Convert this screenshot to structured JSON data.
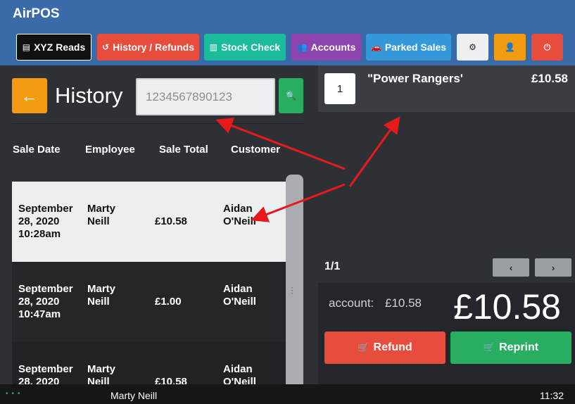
{
  "app": {
    "title": "AirPOS"
  },
  "toolbar": {
    "buttons": [
      {
        "label": "XYZ Reads",
        "icon": "list-icon",
        "glyph": "▤",
        "color": "#111111"
      },
      {
        "label": "History / Refunds",
        "icon": "history-icon",
        "glyph": "↺",
        "color": "#e74c3c"
      },
      {
        "label": "Stock Check",
        "icon": "barcode-icon",
        "glyph": "▥",
        "color": "#1abc9c"
      },
      {
        "label": "Accounts",
        "icon": "users-icon",
        "glyph": "👥",
        "color": "#8e44ad"
      },
      {
        "label": "Parked Sales",
        "icon": "car-icon",
        "glyph": "🚗",
        "color": "#3498db"
      },
      {
        "label": "",
        "icon": "gear-icon",
        "glyph": "⚙",
        "color": "#ecf0f1"
      },
      {
        "label": "",
        "icon": "user-icon",
        "glyph": "👤",
        "color": "#f39c12"
      },
      {
        "label": "",
        "icon": "power-icon",
        "glyph": "⏻",
        "color": "#e74c3c"
      }
    ]
  },
  "history": {
    "back_glyph": "←",
    "title": "History",
    "search_placeholder": "1234567890123",
    "search_glyph": "🔍",
    "columns": [
      "Sale Date",
      "Employee",
      "Sale Total",
      "Customer"
    ],
    "rows": [
      {
        "date": "September 28, 2020 10:28am",
        "employee": "Marty Neill",
        "total": "£10.58",
        "customer": "Aidan O'Neill"
      },
      {
        "date": "September 28, 2020 10:47am",
        "employee": "Marty Neill",
        "total": "£1.00",
        "customer": "Aidan O'Neill"
      },
      {
        "date": "September 28, 2020",
        "employee": "Marty Neill",
        "total": "£10.58",
        "customer": "Aidan O'Neill"
      }
    ]
  },
  "sale": {
    "item": {
      "qty": "1",
      "name": "\"Power Rangers'",
      "price": "£10.58"
    },
    "pager": "1/1",
    "prev_glyph": "‹",
    "next_glyph": "›",
    "account_label": "account:",
    "account_value": "£10.58",
    "grand_total": "£10.58",
    "refund_label": "Refund",
    "reprint_label": "Reprint",
    "cart_glyph": "🛒",
    "refund_color": "#e74c3c",
    "reprint_color": "#27ae60"
  },
  "status": {
    "dots": "•••",
    "user": "Marty Neill",
    "time": "11:32"
  },
  "colors": {
    "topbar": "#3a6aa8",
    "annotation": "#e8191b",
    "accent_orange": "#f39c12",
    "accent_green": "#27ae60"
  }
}
